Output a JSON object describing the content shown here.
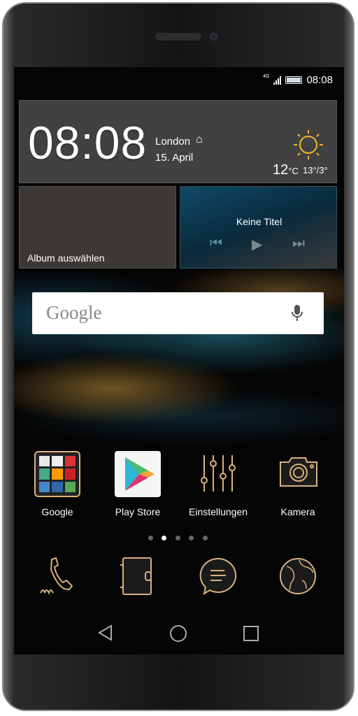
{
  "status": {
    "network": "4G",
    "time": "08:08"
  },
  "clock_widget": {
    "time": "08:08",
    "city": "London",
    "date": "15. April",
    "temperature": "12",
    "unit": "°C",
    "range": "13°/3°",
    "weather_icon": "sun-icon"
  },
  "album_widget": {
    "label": "Album auswählen"
  },
  "music_widget": {
    "title": "Keine Titel"
  },
  "search": {
    "logo": "Google",
    "icon": "microphone-icon"
  },
  "apps": [
    {
      "label": "Google",
      "icon": "google-folder-icon"
    },
    {
      "label": "Play Store",
      "icon": "play-store-icon"
    },
    {
      "label": "Einstellungen",
      "icon": "settings-sliders-icon"
    },
    {
      "label": "Kamera",
      "icon": "camera-icon"
    }
  ],
  "page_indicator": {
    "count": 5,
    "active": 2
  },
  "dock": [
    "phone-icon",
    "contacts-icon",
    "messages-icon",
    "browser-globe-icon"
  ],
  "colors": {
    "accent_gold": "#d9b27c",
    "sun": "#f2b824"
  }
}
